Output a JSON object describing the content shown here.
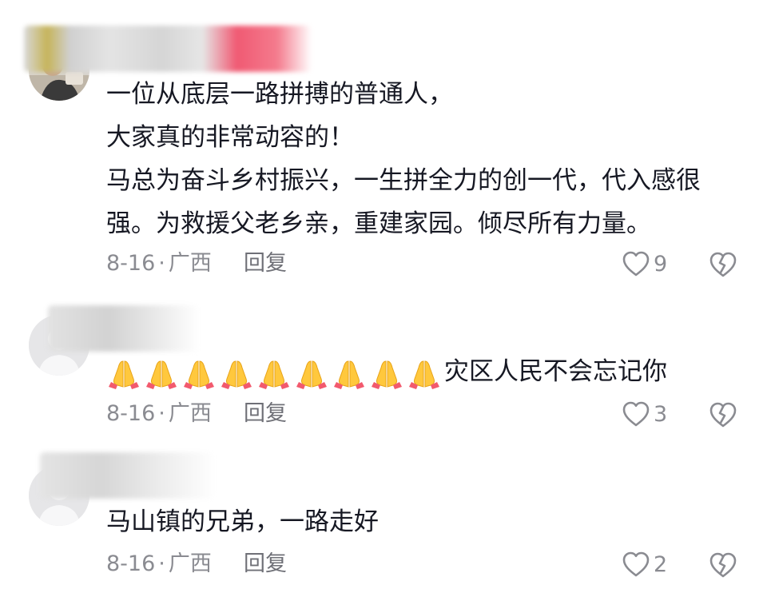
{
  "colors": {
    "text": "#161823",
    "meta": "#8a8b91",
    "reply": "#6f7077",
    "icon": "#8a8b91",
    "name_blur_accent": "#f05a73"
  },
  "comments": [
    {
      "avatar_icon": "user-photo-avatar",
      "username_redacted": true,
      "lines": [
        "一位从底层一路拼搏的普通人，",
        "大家真的非常动容的！",
        "马总为奋斗乡村振兴，一生拼全力的创一代，代入感很",
        "强。为救援父老乡亲，重建家园。倾尽所有力量。"
      ],
      "date": "8-16",
      "separator": "·",
      "region": "广西",
      "reply_label": "回复",
      "likes": "9"
    },
    {
      "avatar_icon": "default-avatar",
      "username_redacted": true,
      "emoji_icon": "folded-hands-emoji",
      "emoji_count": 9,
      "text": "灾区人民不会忘记你",
      "date": "8-16",
      "separator": "·",
      "region": "广西",
      "reply_label": "回复",
      "likes": "3"
    },
    {
      "avatar_icon": "default-avatar",
      "username_redacted": true,
      "text": "马山镇的兄弟，一路走好",
      "date": "8-16",
      "separator": "·",
      "region": "广西",
      "reply_label": "回复",
      "likes": "2"
    }
  ]
}
